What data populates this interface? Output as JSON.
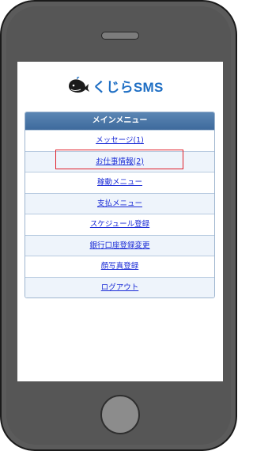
{
  "app": {
    "logo_text": "くじらSMS"
  },
  "menu": {
    "header": "メインメニュー",
    "items": [
      {
        "label": "メッセージ(1)"
      },
      {
        "label": "お仕事情報(2)"
      },
      {
        "label": "稼動メニュー"
      },
      {
        "label": "支払メニュー"
      },
      {
        "label": "スケジュール登録"
      },
      {
        "label": "銀行口座登録変更"
      },
      {
        "label": "顔写真登録"
      },
      {
        "label": "ログアウト"
      }
    ]
  },
  "colors": {
    "link": "#1a2bd6",
    "header_bg": "#4a77a8",
    "highlight": "#e0202a",
    "logo": "#1f6fc4"
  }
}
